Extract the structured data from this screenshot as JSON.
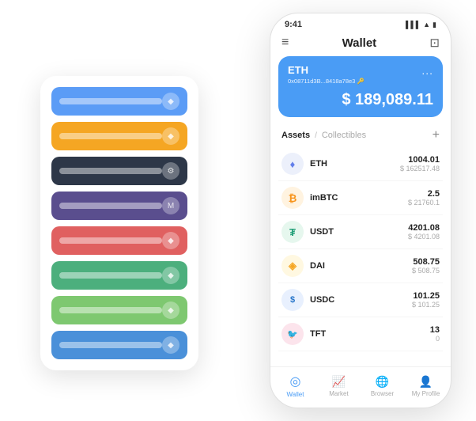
{
  "scene": {
    "back_card": {
      "rows": [
        {
          "color_class": "row-blue",
          "icon": "◆"
        },
        {
          "color_class": "row-orange",
          "icon": "◆"
        },
        {
          "color_class": "row-dark",
          "icon": "⚙"
        },
        {
          "color_class": "row-purple",
          "icon": "M"
        },
        {
          "color_class": "row-red",
          "icon": "◆"
        },
        {
          "color_class": "row-green",
          "icon": "◆"
        },
        {
          "color_class": "row-lightgreen",
          "icon": "◆"
        },
        {
          "color_class": "row-blue2",
          "icon": "◆"
        }
      ]
    },
    "phone": {
      "status": {
        "time": "9:41",
        "signal": "▌▌▌",
        "wifi": "▲",
        "battery": "▮"
      },
      "header": {
        "menu_icon": "≡",
        "title": "Wallet",
        "scan_icon": "⊡"
      },
      "eth_card": {
        "title": "ETH",
        "address": "0x08711d3B...8418a78e3",
        "address_suffix": "🔑",
        "more_icon": "...",
        "amount_prefix": "$",
        "amount": "189,089.11"
      },
      "assets": {
        "tab_active": "Assets",
        "separator": "/",
        "tab_inactive": "Collectibles",
        "add_icon": "+"
      },
      "asset_list": [
        {
          "name": "ETH",
          "icon_class": "icon-eth",
          "icon_text": "♦",
          "primary": "1004.01",
          "secondary": "$ 162517.48"
        },
        {
          "name": "imBTC",
          "icon_class": "icon-imbtc",
          "icon_text": "₿",
          "primary": "2.5",
          "secondary": "$ 21760.1"
        },
        {
          "name": "USDT",
          "icon_class": "icon-usdt",
          "icon_text": "₮",
          "primary": "4201.08",
          "secondary": "$ 4201.08"
        },
        {
          "name": "DAI",
          "icon_class": "icon-dai",
          "icon_text": "◈",
          "primary": "508.75",
          "secondary": "$ 508.75"
        },
        {
          "name": "USDC",
          "icon_class": "icon-usdc",
          "icon_text": "$",
          "primary": "101.25",
          "secondary": "$ 101.25"
        },
        {
          "name": "TFT",
          "icon_class": "icon-tft",
          "icon_text": "🐦",
          "primary": "13",
          "secondary": "0"
        }
      ],
      "bottom_nav": [
        {
          "id": "wallet",
          "icon": "◎",
          "label": "Wallet",
          "active": true
        },
        {
          "id": "market",
          "icon": "📊",
          "label": "Market",
          "active": false
        },
        {
          "id": "browser",
          "icon": "👤",
          "label": "Browser",
          "active": false
        },
        {
          "id": "profile",
          "icon": "👤",
          "label": "My Profile",
          "active": false
        }
      ]
    }
  }
}
